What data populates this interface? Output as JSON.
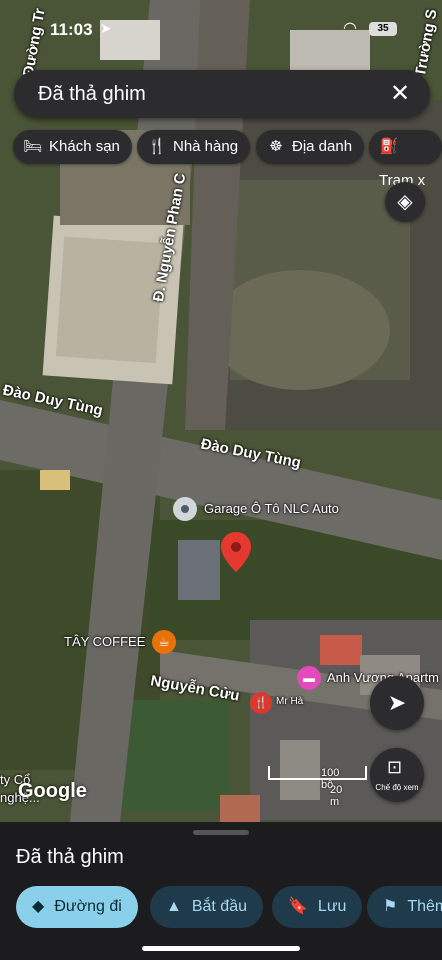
{
  "status_bar": {
    "time": "11:03",
    "battery": "35"
  },
  "search": {
    "query": "Đã thả ghim"
  },
  "chips": [
    {
      "icon": "bed-icon",
      "label": "Khách sạn"
    },
    {
      "icon": "restaurant-icon",
      "label": "Nhà hàng"
    },
    {
      "icon": "landmark-icon",
      "label": "Địa danh"
    },
    {
      "icon": "fuel-icon",
      "label": "Trạm x"
    }
  ],
  "map": {
    "streets": {
      "dao_duy_tung_1": "Đào Duy Tùng",
      "dao_duy_tung_2": "Đào Duy Tùng",
      "nguyen_phan_chanh": "Đ. Nguyễn Phan C",
      "nguyen_cuu": "Nguyễn Cửu",
      "duong_tr": "Đường Tr",
      "truong_s": "Trường S",
      "bottom_left": "ty Cổ",
      "bottom_left_2": "nghệ..."
    },
    "pois": {
      "garage": "Garage Ô Tô NLC Auto",
      "coffee": "TÂY COFFEE",
      "apartment": "Anh Vương Apartm",
      "mr_ha": "Mr Hà"
    },
    "scale": {
      "feet": "100 bộ",
      "meters": "20 m"
    },
    "google_logo": "Google",
    "lens_label": "Chế độ xem"
  },
  "sheet": {
    "title": "Đã thả ghim",
    "actions": [
      "Đường đi",
      "Bắt đầu",
      "Lưu",
      "Thêm"
    ]
  }
}
